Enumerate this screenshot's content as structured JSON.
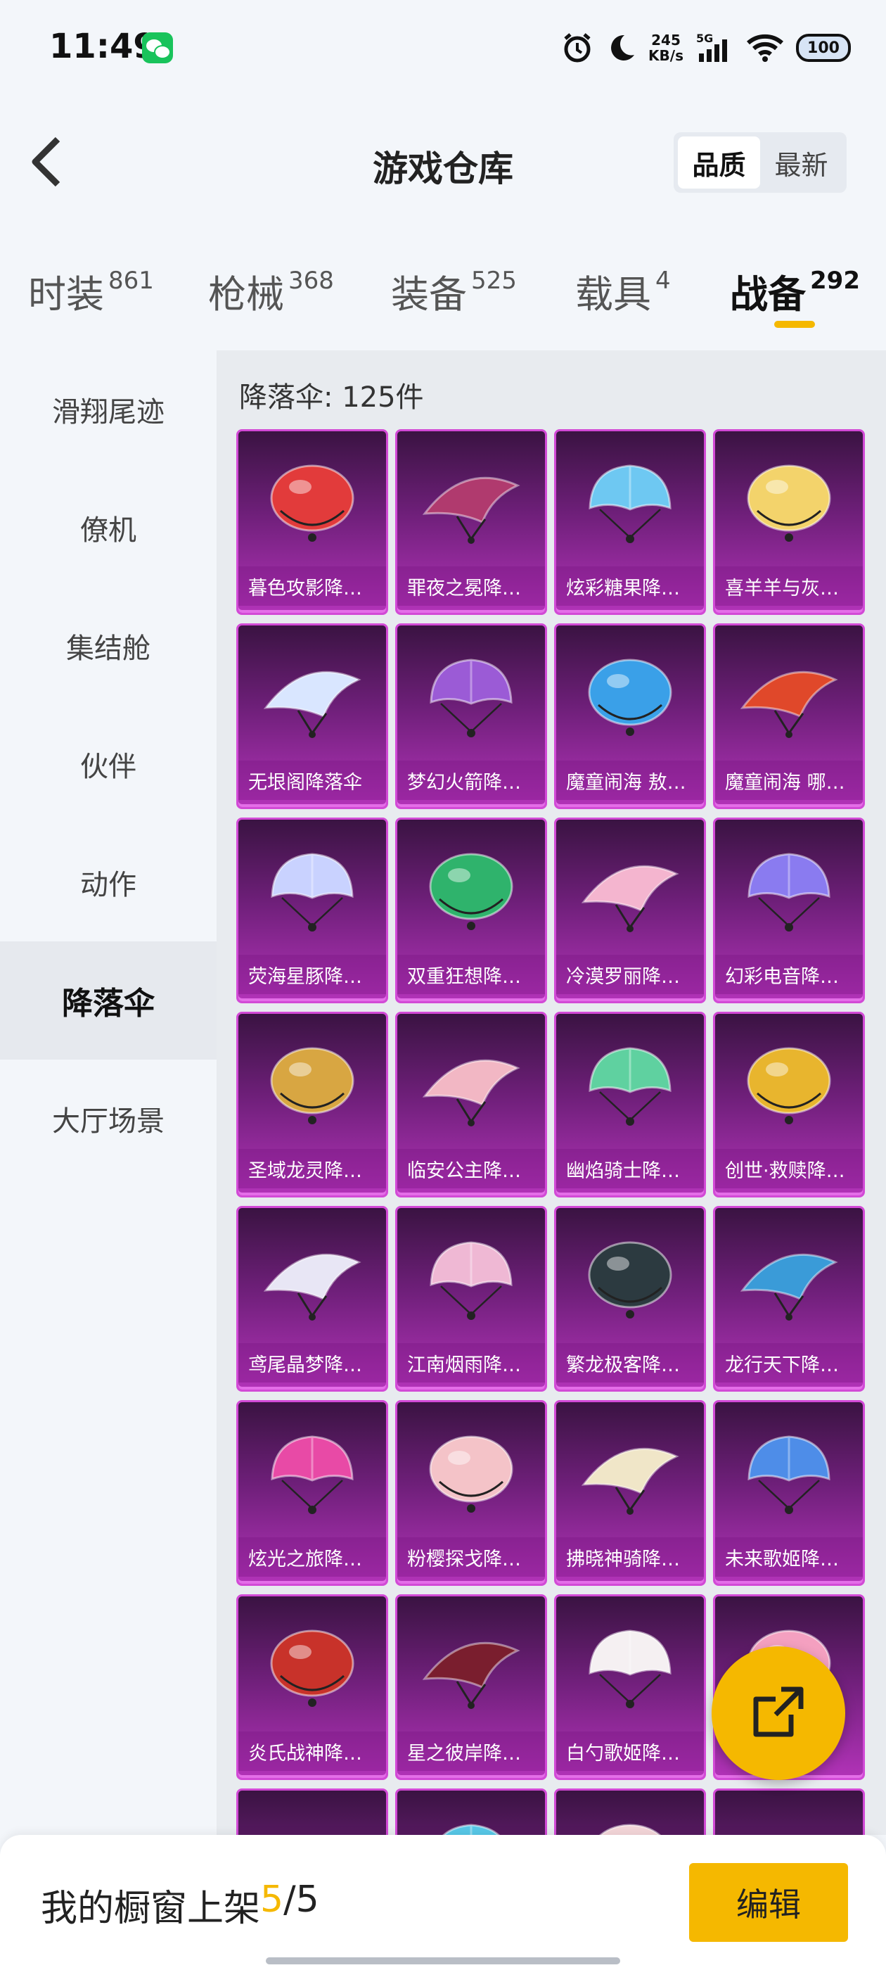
{
  "status_bar": {
    "time": "11:49",
    "net_speed_value": "245",
    "net_speed_unit": "KB/s",
    "network": "5G",
    "battery": "100"
  },
  "header": {
    "title": "游戏仓库",
    "sort_options": [
      "品质",
      "最新"
    ],
    "sort_selected": "品质"
  },
  "tabs": [
    {
      "label": "时装",
      "count": "861"
    },
    {
      "label": "枪械",
      "count": "368"
    },
    {
      "label": "装备",
      "count": "525"
    },
    {
      "label": "载具",
      "count": "4"
    },
    {
      "label": "战备",
      "count": "292"
    }
  ],
  "active_tab": "战备",
  "sidebar": {
    "items": [
      "滑翔尾迹",
      "僚机",
      "集结舱",
      "伙伴",
      "动作",
      "降落伞",
      "大厅场景"
    ],
    "active": "降落伞"
  },
  "section": {
    "title": "降落伞: 125件"
  },
  "items": [
    {
      "name": "暮色攻影降…",
      "icon": "crimson-wing-parachute",
      "color": "#e23b3b"
    },
    {
      "name": "罪夜之冕降…",
      "icon": "heart-crown-parachute",
      "color": "#b03a6e"
    },
    {
      "name": "炫彩糖果降…",
      "icon": "candy-parachute",
      "color": "#6ec8f2"
    },
    {
      "name": "喜羊羊与灰…",
      "icon": "sheep-parachute",
      "color": "#f3d36b"
    },
    {
      "name": "无垠阁降落伞",
      "icon": "crystal-parachute",
      "color": "#d9e6ff"
    },
    {
      "name": "梦幻火箭降…",
      "icon": "rocket-parachute",
      "color": "#9b5bd6"
    },
    {
      "name": "魔童闹海 敖…",
      "icon": "sea-parachute",
      "color": "#3aa0e8"
    },
    {
      "name": "魔童闹海 哪…",
      "icon": "fire-parachute",
      "color": "#e0482a"
    },
    {
      "name": "荧海星豚降…",
      "icon": "star-dolphin-parachute",
      "color": "#c9d2ff"
    },
    {
      "name": "双重狂想降…",
      "icon": "monster-parachute",
      "color": "#2fb36c"
    },
    {
      "name": "冷漠罗丽降…",
      "icon": "pink-lolita-parachute",
      "color": "#f4b5cf"
    },
    {
      "name": "幻彩电音降…",
      "icon": "electro-parachute",
      "color": "#8a7bf0"
    },
    {
      "name": "圣域龙灵降…",
      "icon": "gold-dragon-parachute",
      "color": "#d8a642"
    },
    {
      "name": "临安公主降…",
      "icon": "princess-parachute",
      "color": "#f2b7c4"
    },
    {
      "name": "幽焰骑士降…",
      "icon": "green-knight-parachute",
      "color": "#5fd1a0"
    },
    {
      "name": "创世·救赎降…",
      "icon": "genesis-parachute",
      "color": "#e8b52e"
    },
    {
      "name": "鸢尾晶梦降…",
      "icon": "iris-parachute",
      "color": "#e8e6f5"
    },
    {
      "name": "江南烟雨降…",
      "icon": "lotus-parachute",
      "color": "#efb8d4"
    },
    {
      "name": "繁龙极客降…",
      "icon": "dark-dragon-parachute",
      "color": "#2c3a40"
    },
    {
      "name": "龙行天下降…",
      "icon": "blue-gold-dragon-parachute",
      "color": "#3a9bd8"
    },
    {
      "name": "炫光之旅降…",
      "icon": "rainbow-parachute",
      "color": "#e84aa6"
    },
    {
      "name": "粉樱探戈降…",
      "icon": "sakura-parachute",
      "color": "#f4c3c8"
    },
    {
      "name": "拂晓神骑降…",
      "icon": "dawn-knight-parachute",
      "color": "#f0e6c8"
    },
    {
      "name": "未来歌姬降…",
      "icon": "future-diva-parachute",
      "color": "#4e8de8"
    },
    {
      "name": "炎氏战神降…",
      "icon": "war-god-parachute",
      "color": "#c8322a"
    },
    {
      "name": "星之彼岸降…",
      "icon": "star-shore-parachute",
      "color": "#7a1e2e"
    },
    {
      "name": "白勺歌姬降…",
      "icon": "white-diva-parachute",
      "color": "#f5f0f2"
    },
    {
      "name": "",
      "icon": "pink-parachute",
      "color": "#f4a0c0"
    },
    {
      "name": "",
      "icon": "pink-round-parachute",
      "color": "#f6c0cf"
    },
    {
      "name": "",
      "icon": "cyan-parachute",
      "color": "#58c8e8"
    },
    {
      "name": "",
      "icon": "white-round-parachute",
      "color": "#f4d6d9"
    },
    {
      "name": "",
      "icon": "duck-parachute",
      "color": "#f0c030"
    }
  ],
  "bottom_bar": {
    "showcase_label": "我的橱窗上架",
    "showcase_current": "5",
    "showcase_sep": "/",
    "showcase_total": "5",
    "edit_label": "编辑"
  },
  "colors": {
    "accent": "#f5b800",
    "card_border": "#d24ad6",
    "card_bg": "#6e1f79"
  }
}
